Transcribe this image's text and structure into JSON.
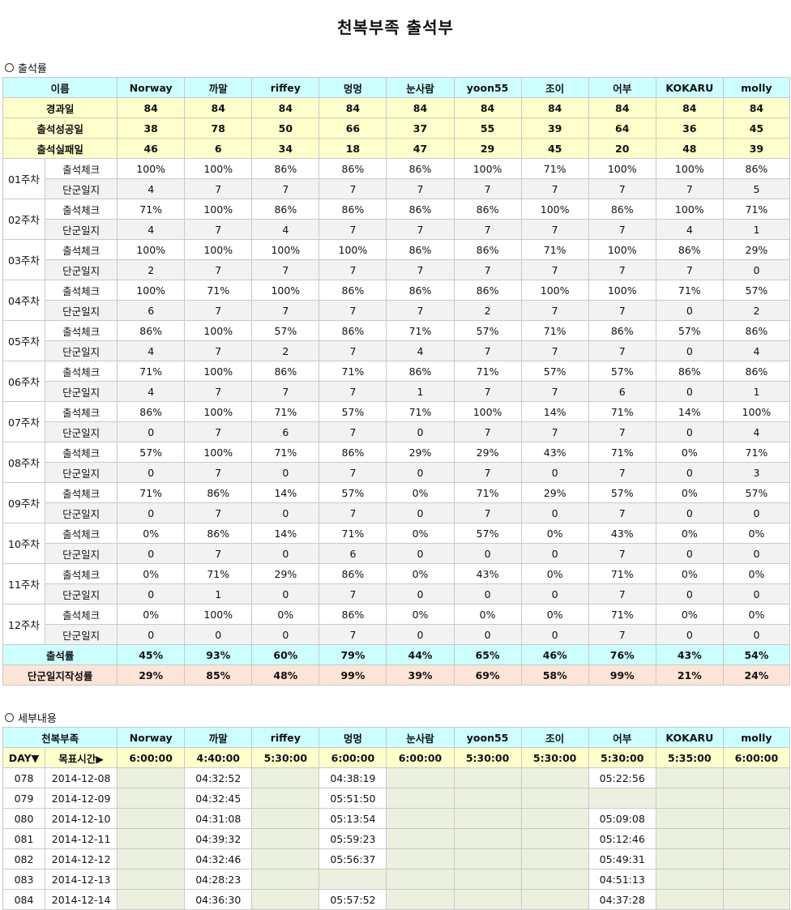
{
  "title": "천복부족 출석부",
  "section1": "출석률",
  "section2": "세부내용",
  "members": [
    "Norway",
    "까말",
    "riffey",
    "멍멍",
    "눈사람",
    "yoon55",
    "조이",
    "어부",
    "KOKARU",
    "molly"
  ],
  "header_name": "이름",
  "summary": [
    {
      "label": "경과일",
      "values": [
        "84",
        "84",
        "84",
        "84",
        "84",
        "84",
        "84",
        "84",
        "84",
        "84"
      ]
    },
    {
      "label": "출석성공일",
      "values": [
        "38",
        "78",
        "50",
        "66",
        "37",
        "55",
        "39",
        "64",
        "36",
        "45"
      ]
    },
    {
      "label": "출석실패일",
      "values": [
        "46",
        "6",
        "34",
        "18",
        "47",
        "29",
        "45",
        "20",
        "48",
        "39"
      ]
    }
  ],
  "check_label": "출석체크",
  "log_label": "단군일지",
  "weeks": [
    {
      "week": "01주차",
      "check": [
        "100%",
        "100%",
        "86%",
        "86%",
        "86%",
        "100%",
        "71%",
        "100%",
        "100%",
        "86%"
      ],
      "log": [
        "4",
        "7",
        "7",
        "7",
        "7",
        "7",
        "7",
        "7",
        "7",
        "5"
      ]
    },
    {
      "week": "02주차",
      "check": [
        "71%",
        "100%",
        "86%",
        "86%",
        "86%",
        "86%",
        "100%",
        "86%",
        "100%",
        "71%"
      ],
      "log": [
        "4",
        "7",
        "4",
        "7",
        "7",
        "7",
        "7",
        "7",
        "4",
        "1"
      ]
    },
    {
      "week": "03주차",
      "check": [
        "100%",
        "100%",
        "100%",
        "100%",
        "86%",
        "86%",
        "71%",
        "100%",
        "86%",
        "29%"
      ],
      "log": [
        "2",
        "7",
        "7",
        "7",
        "7",
        "7",
        "7",
        "7",
        "7",
        "0"
      ]
    },
    {
      "week": "04주차",
      "check": [
        "100%",
        "71%",
        "100%",
        "86%",
        "86%",
        "86%",
        "100%",
        "100%",
        "71%",
        "57%"
      ],
      "log": [
        "6",
        "7",
        "7",
        "7",
        "7",
        "2",
        "7",
        "7",
        "0",
        "2"
      ]
    },
    {
      "week": "05주차",
      "check": [
        "86%",
        "100%",
        "57%",
        "86%",
        "71%",
        "57%",
        "71%",
        "86%",
        "57%",
        "86%"
      ],
      "log": [
        "4",
        "7",
        "2",
        "7",
        "4",
        "7",
        "7",
        "7",
        "0",
        "4"
      ]
    },
    {
      "week": "06주차",
      "check": [
        "71%",
        "100%",
        "86%",
        "71%",
        "86%",
        "71%",
        "57%",
        "57%",
        "86%",
        "86%"
      ],
      "log": [
        "4",
        "7",
        "7",
        "7",
        "1",
        "7",
        "7",
        "6",
        "0",
        "1"
      ]
    },
    {
      "week": "07주차",
      "check": [
        "86%",
        "100%",
        "71%",
        "57%",
        "71%",
        "100%",
        "14%",
        "71%",
        "14%",
        "100%"
      ],
      "log": [
        "0",
        "7",
        "6",
        "7",
        "0",
        "7",
        "7",
        "7",
        "0",
        "4"
      ]
    },
    {
      "week": "08주차",
      "check": [
        "57%",
        "100%",
        "71%",
        "86%",
        "29%",
        "29%",
        "43%",
        "71%",
        "0%",
        "71%"
      ],
      "log": [
        "0",
        "7",
        "0",
        "7",
        "0",
        "7",
        "0",
        "7",
        "0",
        "3"
      ]
    },
    {
      "week": "09주차",
      "check": [
        "71%",
        "86%",
        "14%",
        "57%",
        "0%",
        "71%",
        "29%",
        "57%",
        "0%",
        "57%"
      ],
      "log": [
        "0",
        "7",
        "0",
        "7",
        "0",
        "7",
        "0",
        "7",
        "0",
        "0"
      ]
    },
    {
      "week": "10주차",
      "check": [
        "0%",
        "86%",
        "14%",
        "71%",
        "0%",
        "57%",
        "0%",
        "43%",
        "0%",
        "0%"
      ],
      "log": [
        "0",
        "7",
        "0",
        "6",
        "0",
        "0",
        "0",
        "7",
        "0",
        "0"
      ]
    },
    {
      "week": "11주차",
      "check": [
        "0%",
        "71%",
        "29%",
        "86%",
        "0%",
        "43%",
        "0%",
        "71%",
        "0%",
        "0%"
      ],
      "log": [
        "0",
        "1",
        "0",
        "7",
        "0",
        "0",
        "0",
        "7",
        "0",
        "0"
      ]
    },
    {
      "week": "12주차",
      "check": [
        "0%",
        "100%",
        "0%",
        "86%",
        "0%",
        "0%",
        "0%",
        "71%",
        "0%",
        "0%"
      ],
      "log": [
        "0",
        "0",
        "0",
        "7",
        "0",
        "0",
        "0",
        "7",
        "0",
        "0"
      ]
    }
  ],
  "attendance_rate": {
    "label": "출석률",
    "values": [
      "45%",
      "93%",
      "60%",
      "79%",
      "44%",
      "65%",
      "46%",
      "76%",
      "43%",
      "54%"
    ]
  },
  "log_rate": {
    "label": "단군일지작성률",
    "values": [
      "29%",
      "85%",
      "48%",
      "99%",
      "39%",
      "69%",
      "58%",
      "99%",
      "21%",
      "24%"
    ]
  },
  "detail_header": "천복부족",
  "day_label": "DAY▼",
  "target_label": "목표시간▶",
  "targets": [
    "6:00:00",
    "4:40:00",
    "5:30:00",
    "6:00:00",
    "6:00:00",
    "5:30:00",
    "5:30:00",
    "5:30:00",
    "5:35:00",
    "6:00:00"
  ],
  "days": [
    {
      "day": "078",
      "date": "2014-12-08",
      "times": [
        "",
        "04:32:52",
        "",
        "04:38:19",
        "",
        "",
        "",
        "05:22:56",
        "",
        ""
      ]
    },
    {
      "day": "079",
      "date": "2014-12-09",
      "times": [
        "",
        "04:32:45",
        "",
        "05:51:50",
        "",
        "",
        "",
        "",
        "",
        ""
      ]
    },
    {
      "day": "080",
      "date": "2014-12-10",
      "times": [
        "",
        "04:31:08",
        "",
        "05:13:54",
        "",
        "",
        "",
        "05:09:08",
        "",
        ""
      ]
    },
    {
      "day": "081",
      "date": "2014-12-11",
      "times": [
        "",
        "04:39:32",
        "",
        "05:59:23",
        "",
        "",
        "",
        "05:12:46",
        "",
        ""
      ]
    },
    {
      "day": "082",
      "date": "2014-12-12",
      "times": [
        "",
        "04:32:46",
        "",
        "05:56:37",
        "",
        "",
        "",
        "05:49:31",
        "",
        ""
      ]
    },
    {
      "day": "083",
      "date": "2014-12-13",
      "times": [
        "",
        "04:28:23",
        "",
        "",
        "",
        "",
        "",
        "04:51:13",
        "",
        ""
      ]
    },
    {
      "day": "084",
      "date": "2014-12-14",
      "times": [
        "",
        "04:36:30",
        "",
        "05:57:52",
        "",
        "",
        "",
        "04:37:28",
        "",
        ""
      ]
    }
  ]
}
